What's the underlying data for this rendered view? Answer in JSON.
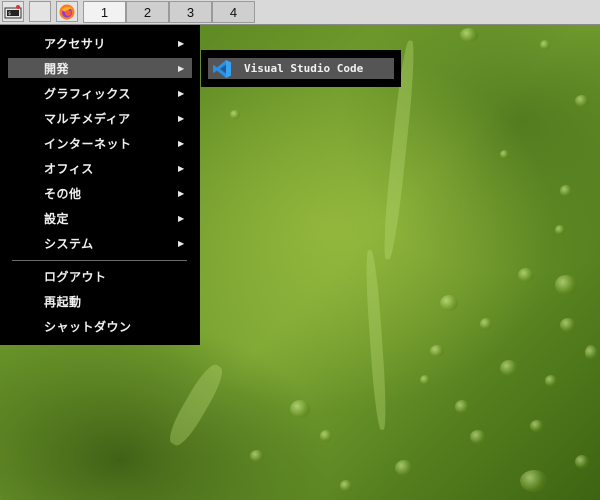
{
  "taskbar": {
    "launchers": [
      {
        "name": "terminal-icon"
      },
      {
        "name": "blank"
      },
      {
        "name": "firefox-icon"
      }
    ],
    "workspaces": [
      "1",
      "2",
      "3",
      "4"
    ],
    "active_workspace": "1"
  },
  "menu": {
    "items": [
      {
        "label": "アクセサリ",
        "submenu": true
      },
      {
        "label": "開発",
        "submenu": true,
        "highlighted": true
      },
      {
        "label": "グラフィックス",
        "submenu": true
      },
      {
        "label": "マルチメディア",
        "submenu": true
      },
      {
        "label": "インターネット",
        "submenu": true
      },
      {
        "label": "オフィス",
        "submenu": true
      },
      {
        "label": "その他",
        "submenu": true
      },
      {
        "label": "設定",
        "submenu": true
      },
      {
        "label": "システム",
        "submenu": true
      }
    ],
    "actions": [
      {
        "label": "ログアウト"
      },
      {
        "label": "再起動"
      },
      {
        "label": "シャットダウン"
      }
    ],
    "arrow": "▶"
  },
  "submenu": {
    "items": [
      {
        "label": "Visual Studio Code",
        "icon": "vscode-icon"
      }
    ]
  },
  "colors": {
    "menu_bg": "#000000",
    "highlight": "#555555",
    "vscode_blue": "#2d8fe0"
  }
}
